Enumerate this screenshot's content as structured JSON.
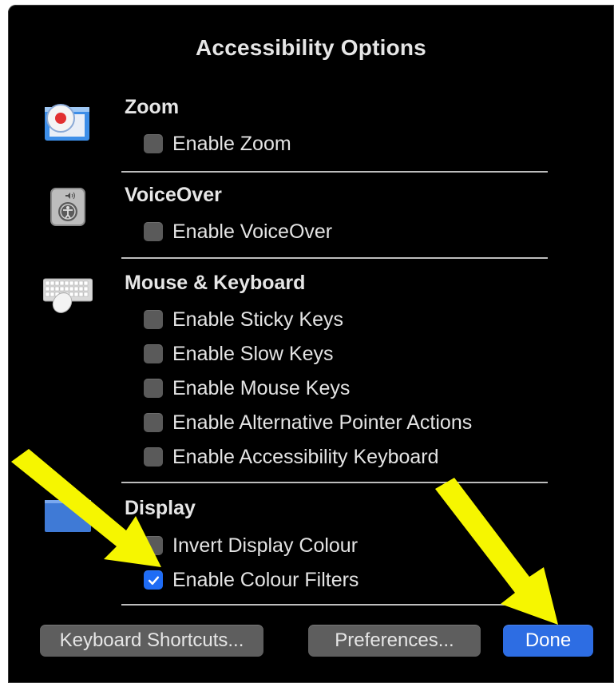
{
  "dialog": {
    "title": "Accessibility Options"
  },
  "sections": {
    "zoom": {
      "title": "Zoom",
      "icon": "zoom-window-icon",
      "options": [
        {
          "label": "Enable Zoom",
          "checked": false
        }
      ]
    },
    "voiceover": {
      "title": "VoiceOver",
      "icon": "voiceover-icon",
      "options": [
        {
          "label": "Enable VoiceOver",
          "checked": false
        }
      ]
    },
    "mouse_keyboard": {
      "title": "Mouse & Keyboard",
      "icon": "keyboard-mouse-icon",
      "options": [
        {
          "label": "Enable Sticky Keys",
          "checked": false
        },
        {
          "label": "Enable Slow Keys",
          "checked": false
        },
        {
          "label": "Enable Mouse Keys",
          "checked": false
        },
        {
          "label": "Enable Alternative Pointer Actions",
          "checked": false
        },
        {
          "label": "Enable Accessibility Keyboard",
          "checked": false
        }
      ]
    },
    "display": {
      "title": "Display",
      "icon": "display-icon",
      "options": [
        {
          "label": "Invert Display Colour",
          "checked": false
        },
        {
          "label": "Enable Colour Filters",
          "checked": true
        }
      ]
    }
  },
  "buttons": {
    "keyboard_shortcuts": "Keyboard Shortcuts...",
    "preferences": "Preferences...",
    "done": "Done"
  },
  "colors": {
    "background": "#000000",
    "accent": "#2d6de3",
    "annotation_arrow": "#f6f600"
  },
  "annotations": {
    "arrows": [
      "arrow-to-enable-colour-filters",
      "arrow-to-done-button"
    ]
  }
}
